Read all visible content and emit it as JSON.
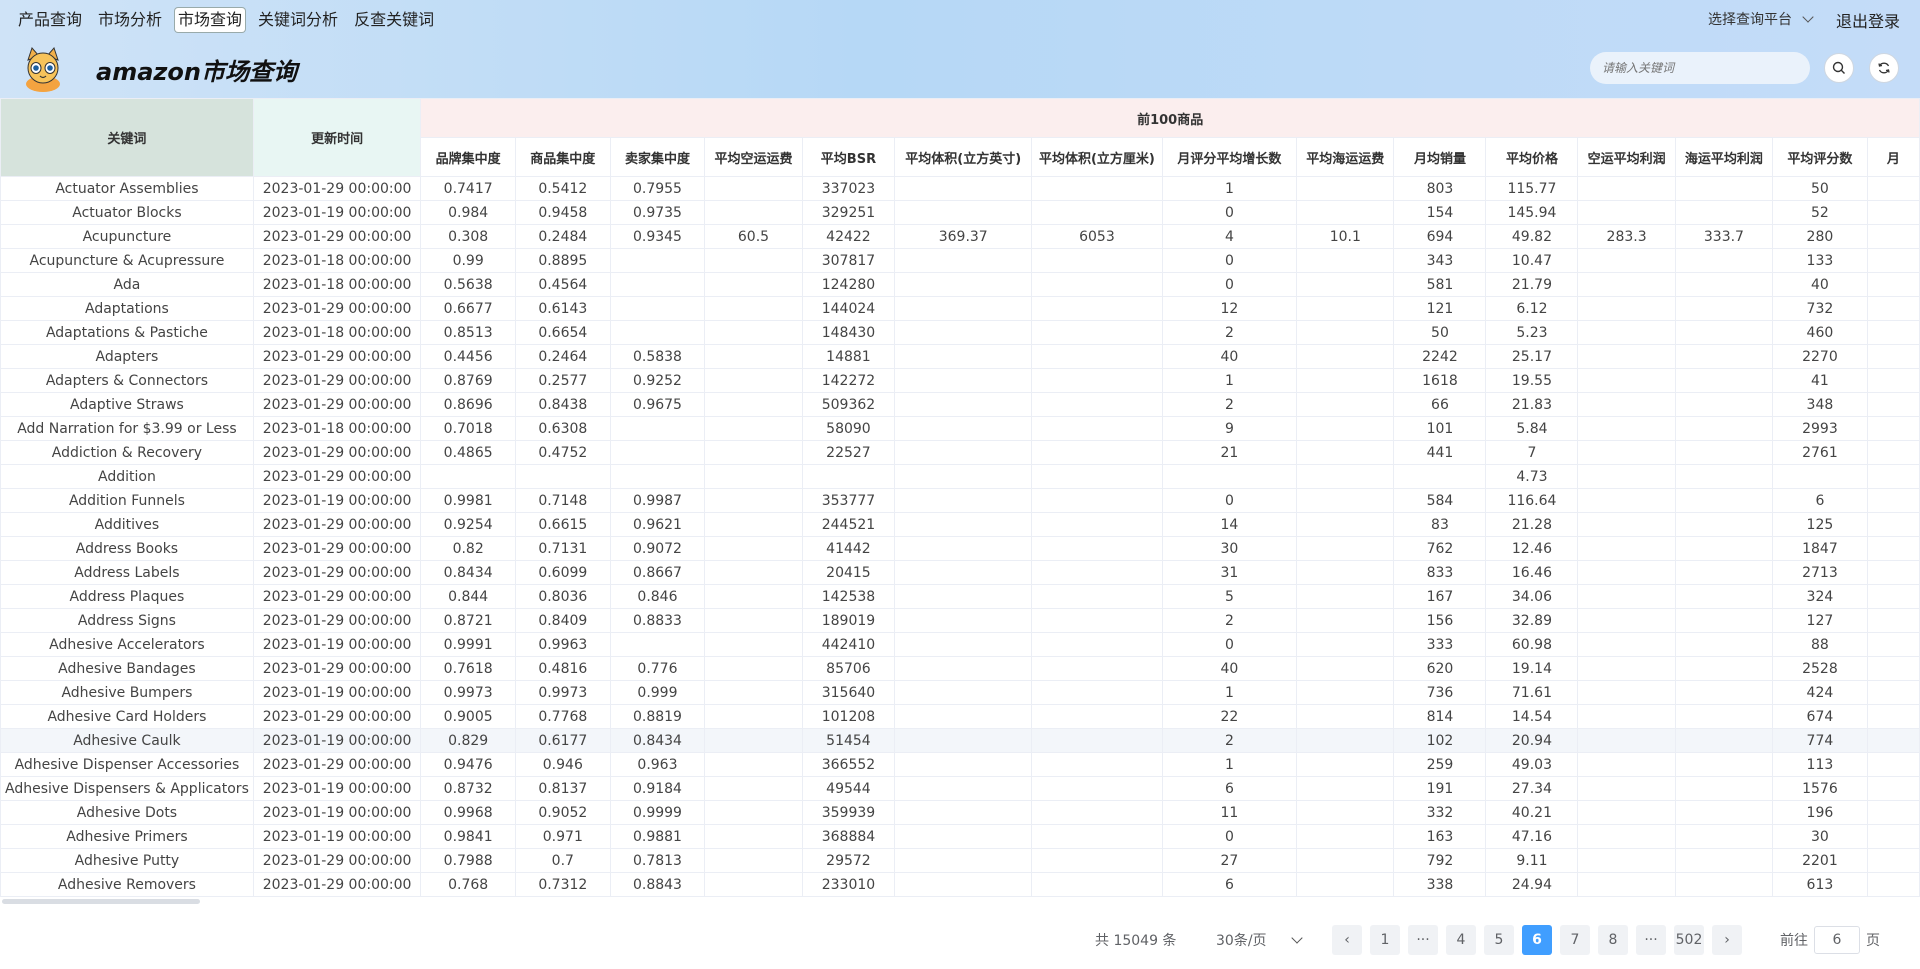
{
  "nav": [
    {
      "label": "产品查询",
      "active": false
    },
    {
      "label": "市场分析",
      "active": false
    },
    {
      "label": "市场查询",
      "active": true
    },
    {
      "label": "关键词分析",
      "active": false
    },
    {
      "label": "反查关键词",
      "active": false
    }
  ],
  "platform_label": "选择查询平台",
  "logout_label": "退出登录",
  "app_title": "amazon市场查询",
  "search": {
    "placeholder": "请输入关键词"
  },
  "table": {
    "kw_header": "关键词",
    "time_header": "更新时间",
    "group_header": "前100商品",
    "columns": [
      "品牌集中度",
      "商品集中度",
      "卖家集中度",
      "平均空运运费",
      "平均BSR",
      "平均体积(立方英寸)",
      "平均体积(立方厘米)",
      "月评分平均增长数",
      "平均海运运费",
      "月均销量",
      "平均价格",
      "空运平均利润",
      "海运平均利润",
      "平均评分数",
      "月"
    ],
    "rows": [
      [
        "Actuator Assemblies",
        "2023-01-29 00:00:00",
        "0.7417",
        "0.5412",
        "0.7955",
        "",
        "337023",
        "",
        "",
        "1",
        "",
        "803",
        "115.77",
        "",
        "",
        "50",
        ""
      ],
      [
        "Actuator Blocks",
        "2023-01-19 00:00:00",
        "0.984",
        "0.9458",
        "0.9735",
        "",
        "329251",
        "",
        "",
        "0",
        "",
        "154",
        "145.94",
        "",
        "",
        "52",
        ""
      ],
      [
        "Acupuncture",
        "2023-01-29 00:00:00",
        "0.308",
        "0.2484",
        "0.9345",
        "60.5",
        "42422",
        "369.37",
        "6053",
        "4",
        "10.1",
        "694",
        "49.82",
        "283.3",
        "333.7",
        "280",
        ""
      ],
      [
        "Acupuncture & Acupressure",
        "2023-01-18 00:00:00",
        "0.99",
        "0.8895",
        "",
        "",
        "307817",
        "",
        "",
        "0",
        "",
        "343",
        "10.47",
        "",
        "",
        "133",
        ""
      ],
      [
        "Ada",
        "2023-01-18 00:00:00",
        "0.5638",
        "0.4564",
        "",
        "",
        "124280",
        "",
        "",
        "0",
        "",
        "581",
        "21.79",
        "",
        "",
        "40",
        ""
      ],
      [
        "Adaptations",
        "2023-01-29 00:00:00",
        "0.6677",
        "0.6143",
        "",
        "",
        "144024",
        "",
        "",
        "12",
        "",
        "121",
        "6.12",
        "",
        "",
        "732",
        ""
      ],
      [
        "Adaptations & Pastiche",
        "2023-01-18 00:00:00",
        "0.8513",
        "0.6654",
        "",
        "",
        "148430",
        "",
        "",
        "2",
        "",
        "50",
        "5.23",
        "",
        "",
        "460",
        ""
      ],
      [
        "Adapters",
        "2023-01-29 00:00:00",
        "0.4456",
        "0.2464",
        "0.5838",
        "",
        "14881",
        "",
        "",
        "40",
        "",
        "2242",
        "25.17",
        "",
        "",
        "2270",
        ""
      ],
      [
        "Adapters & Connectors",
        "2023-01-29 00:00:00",
        "0.8769",
        "0.2577",
        "0.9252",
        "",
        "142272",
        "",
        "",
        "1",
        "",
        "1618",
        "19.55",
        "",
        "",
        "41",
        ""
      ],
      [
        "Adaptive Straws",
        "2023-01-29 00:00:00",
        "0.8696",
        "0.8438",
        "0.9675",
        "",
        "509362",
        "",
        "",
        "2",
        "",
        "66",
        "21.83",
        "",
        "",
        "348",
        ""
      ],
      [
        "Add Narration for $3.99 or Less",
        "2023-01-18 00:00:00",
        "0.7018",
        "0.6308",
        "",
        "",
        "58090",
        "",
        "",
        "9",
        "",
        "101",
        "5.84",
        "",
        "",
        "2993",
        ""
      ],
      [
        "Addiction & Recovery",
        "2023-01-29 00:00:00",
        "0.4865",
        "0.4752",
        "",
        "",
        "22527",
        "",
        "",
        "21",
        "",
        "441",
        "7",
        "",
        "",
        "2761",
        ""
      ],
      [
        "Addition",
        "2023-01-29 00:00:00",
        "",
        "",
        "",
        "",
        "",
        "",
        "",
        "",
        "",
        "",
        "4.73",
        "",
        "",
        "",
        ""
      ],
      [
        "Addition Funnels",
        "2023-01-19 00:00:00",
        "0.9981",
        "0.7148",
        "0.9987",
        "",
        "353777",
        "",
        "",
        "0",
        "",
        "584",
        "116.64",
        "",
        "",
        "6",
        ""
      ],
      [
        "Additives",
        "2023-01-29 00:00:00",
        "0.9254",
        "0.6615",
        "0.9621",
        "",
        "244521",
        "",
        "",
        "14",
        "",
        "83",
        "21.28",
        "",
        "",
        "125",
        ""
      ],
      [
        "Address Books",
        "2023-01-29 00:00:00",
        "0.82",
        "0.7131",
        "0.9072",
        "",
        "41442",
        "",
        "",
        "30",
        "",
        "762",
        "12.46",
        "",
        "",
        "1847",
        ""
      ],
      [
        "Address Labels",
        "2023-01-29 00:00:00",
        "0.8434",
        "0.6099",
        "0.8667",
        "",
        "20415",
        "",
        "",
        "31",
        "",
        "833",
        "16.46",
        "",
        "",
        "2713",
        ""
      ],
      [
        "Address Plaques",
        "2023-01-29 00:00:00",
        "0.844",
        "0.8036",
        "0.846",
        "",
        "142538",
        "",
        "",
        "5",
        "",
        "167",
        "34.06",
        "",
        "",
        "324",
        ""
      ],
      [
        "Address Signs",
        "2023-01-29 00:00:00",
        "0.8721",
        "0.8409",
        "0.8833",
        "",
        "189019",
        "",
        "",
        "2",
        "",
        "156",
        "32.89",
        "",
        "",
        "127",
        ""
      ],
      [
        "Adhesive Accelerators",
        "2023-01-19 00:00:00",
        "0.9991",
        "0.9963",
        "",
        "",
        "442410",
        "",
        "",
        "0",
        "",
        "333",
        "60.98",
        "",
        "",
        "88",
        ""
      ],
      [
        "Adhesive Bandages",
        "2023-01-29 00:00:00",
        "0.7618",
        "0.4816",
        "0.776",
        "",
        "85706",
        "",
        "",
        "40",
        "",
        "620",
        "19.14",
        "",
        "",
        "2528",
        ""
      ],
      [
        "Adhesive Bumpers",
        "2023-01-19 00:00:00",
        "0.9973",
        "0.9973",
        "0.999",
        "",
        "315640",
        "",
        "",
        "1",
        "",
        "736",
        "71.61",
        "",
        "",
        "424",
        ""
      ],
      [
        "Adhesive Card Holders",
        "2023-01-29 00:00:00",
        "0.9005",
        "0.7768",
        "0.8819",
        "",
        "101208",
        "",
        "",
        "22",
        "",
        "814",
        "14.54",
        "",
        "",
        "674",
        ""
      ],
      [
        "Adhesive Caulk",
        "2023-01-19 00:00:00",
        "0.829",
        "0.6177",
        "0.8434",
        "",
        "51454",
        "",
        "",
        "2",
        "",
        "102",
        "20.94",
        "",
        "",
        "774",
        ""
      ],
      [
        "Adhesive Dispenser Accessories",
        "2023-01-29 00:00:00",
        "0.9476",
        "0.946",
        "0.963",
        "",
        "366552",
        "",
        "",
        "1",
        "",
        "259",
        "49.03",
        "",
        "",
        "113",
        ""
      ],
      [
        "Adhesive Dispensers & Applicators",
        "2023-01-19 00:00:00",
        "0.8732",
        "0.8137",
        "0.9184",
        "",
        "49544",
        "",
        "",
        "6",
        "",
        "191",
        "27.34",
        "",
        "",
        "1576",
        ""
      ],
      [
        "Adhesive Dots",
        "2023-01-19 00:00:00",
        "0.9968",
        "0.9052",
        "0.9999",
        "",
        "359939",
        "",
        "",
        "11",
        "",
        "332",
        "40.21",
        "",
        "",
        "196",
        ""
      ],
      [
        "Adhesive Primers",
        "2023-01-19 00:00:00",
        "0.9841",
        "0.971",
        "0.9881",
        "",
        "368884",
        "",
        "",
        "0",
        "",
        "163",
        "47.16",
        "",
        "",
        "30",
        ""
      ],
      [
        "Adhesive Putty",
        "2023-01-29 00:00:00",
        "0.7988",
        "0.7",
        "0.7813",
        "",
        "29572",
        "",
        "",
        "27",
        "",
        "792",
        "9.11",
        "",
        "",
        "2201",
        ""
      ],
      [
        "Adhesive Removers",
        "2023-01-29 00:00:00",
        "0.768",
        "0.7312",
        "0.8843",
        "",
        "233010",
        "",
        "",
        "6",
        "",
        "338",
        "24.94",
        "",
        "",
        "613",
        ""
      ]
    ],
    "highlight_row": 23
  },
  "pagination": {
    "total_text": "共 15049 条",
    "page_size": "30条/页",
    "items": [
      "‹",
      "1",
      "···",
      "4",
      "5",
      "6",
      "7",
      "8",
      "···",
      "502",
      "›"
    ],
    "active": "6",
    "goto_label": "前往",
    "goto_value": "6",
    "page_suffix": "页"
  },
  "colors": {
    "accent": "#409eff"
  }
}
